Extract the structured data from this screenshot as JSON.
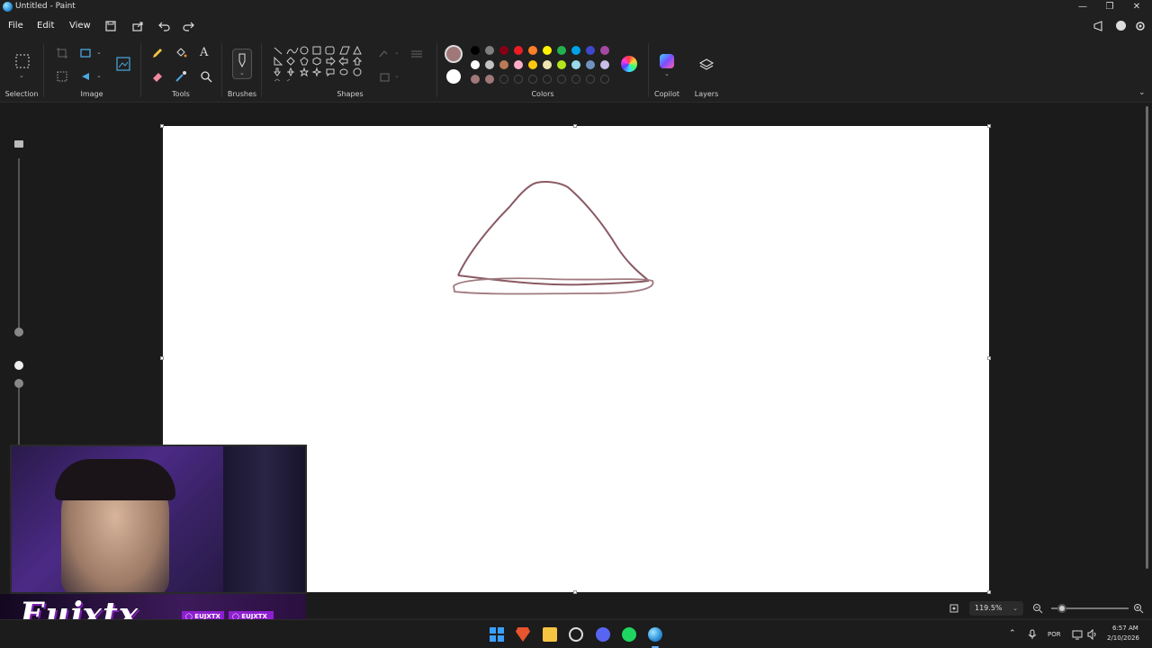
{
  "window": {
    "title": "Untitled - Paint"
  },
  "menu": {
    "file": "File",
    "edit": "Edit",
    "view": "View"
  },
  "ribbon": {
    "groups": {
      "selection": "Selection",
      "image": "Image",
      "tools": "Tools",
      "brushes": "Brushes",
      "shapes": "Shapes",
      "colors": "Colors",
      "copilot": "Copilot",
      "layers": "Layers"
    },
    "colors": {
      "primary": "#a07878",
      "secondary": "#ffffff",
      "row1": [
        "#000000",
        "#7f7f7f",
        "#880015",
        "#ed1c24",
        "#ff7f27",
        "#fff200",
        "#22b14c",
        "#00a2e8",
        "#3f48cc",
        "#a349a4"
      ],
      "row2": [
        "#ffffff",
        "#c3c3c3",
        "#b97a57",
        "#ffaec9",
        "#ffc90e",
        "#efe4b0",
        "#b5e61d",
        "#99d9ea",
        "#7092be",
        "#c8bfe7"
      ],
      "row3": [
        "#a07878",
        "#a07878"
      ]
    }
  },
  "status": {
    "zoom": "119.5%"
  },
  "overlay": {
    "name": "Eujxtx",
    "instagram": "EUJXTX",
    "tiktok": "EUJXTX_"
  },
  "tray": {
    "language": "POR",
    "time": "6:57 AM",
    "date": "2/10/2026"
  }
}
